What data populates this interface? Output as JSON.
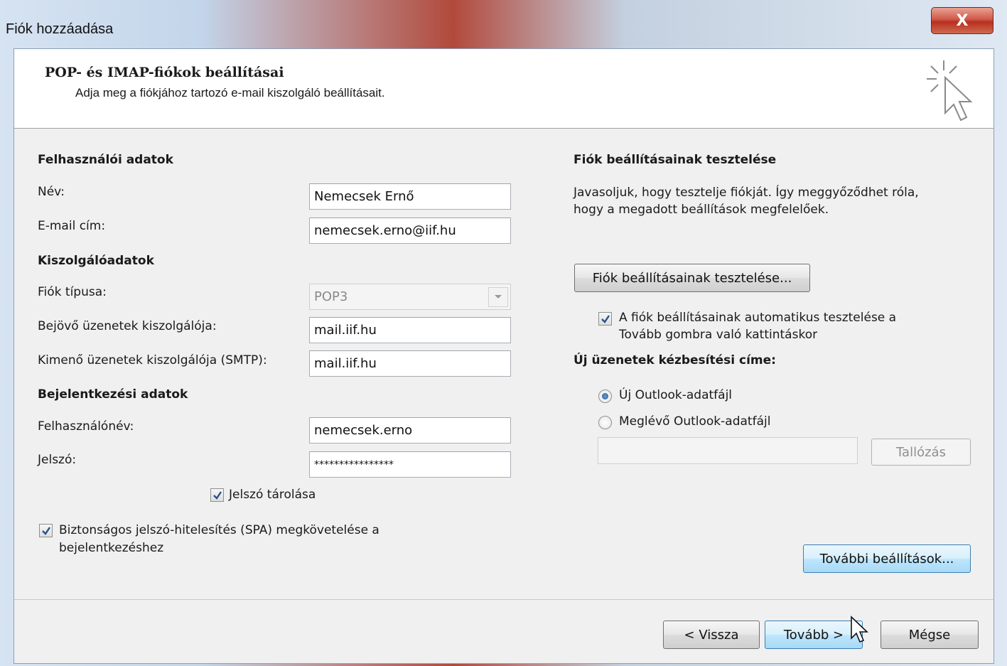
{
  "window": {
    "title": "Fiók hozzáadása",
    "close_glyph": "X"
  },
  "header": {
    "title": "POP- és IMAP-fiókok beállításai",
    "subtitle": "Adja meg a fiókjához tartozó e-mail kiszolgáló beállításait.",
    "icon": "cursor-sparkle-icon"
  },
  "user_info": {
    "section_label": "Felhasználói adatok",
    "name_label": "Név:",
    "name_value": "Nemecsek Ernő",
    "email_label": "E-mail cím:",
    "email_value": "nemecsek.erno@iif.hu"
  },
  "server_info": {
    "section_label": "Kiszolgálóadatok",
    "account_type_label": "Fiók típusa:",
    "account_type_value": "POP3",
    "incoming_label": "Bejövő üzenetek kiszolgálója:",
    "incoming_value": "mail.iif.hu",
    "outgoing_label": "Kimenő üzenetek kiszolgálója (SMTP):",
    "outgoing_value": "mail.iif.hu"
  },
  "logon_info": {
    "section_label": "Bejelentkezési adatok",
    "username_label": "Felhasználónév:",
    "username_value": "nemecsek.erno",
    "password_label": "Jelszó:",
    "password_value": "****************",
    "remember_password_label": "Jelszó tárolása",
    "remember_password_checked": true,
    "spa_label_line1": "Biztonságos jelszó-hitelesítés (SPA) megkövetelése a",
    "spa_label_line2": "bejelentkezéshez",
    "spa_checked": true
  },
  "test_settings": {
    "section_label": "Fiók beállításainak tesztelése",
    "description_line1": "Javasoljuk, hogy tesztelje fiókját. Így meggyőződhet róla,",
    "description_line2": "hogy a megadott beállítások megfelelőek.",
    "test_button": "Fiók beállításainak tesztelése...",
    "auto_test_line1": "A fiók beállításainak automatikus tesztelése a",
    "auto_test_line2": "Tovább gombra való kattintáskor",
    "auto_test_checked": true
  },
  "delivery": {
    "section_label": "Új üzenetek kézbesítési címe:",
    "option_new": "Új Outlook-adatfájl",
    "option_existing": "Meglévő Outlook-adatfájl",
    "selected": "new",
    "existing_path": "",
    "browse_button": "Tallózás"
  },
  "more_settings_button": "További beállítások...",
  "footer": {
    "back_button": "< Vissza",
    "next_button": "Tovább >",
    "cancel_button": "Mégse"
  }
}
